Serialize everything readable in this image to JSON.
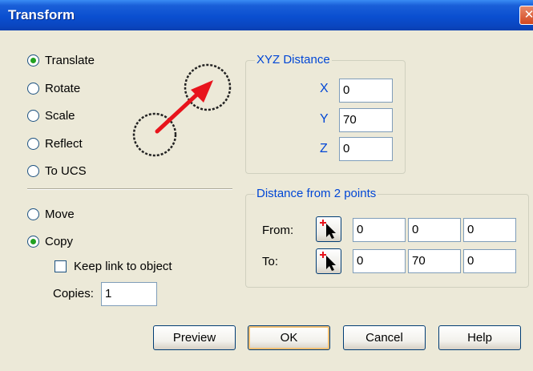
{
  "window": {
    "title": "Transform",
    "close_glyph": "✕"
  },
  "operation": {
    "options": [
      {
        "label": "Translate",
        "checked": true
      },
      {
        "label": "Rotate",
        "checked": false
      },
      {
        "label": "Scale",
        "checked": false
      },
      {
        "label": "Reflect",
        "checked": false
      },
      {
        "label": "To UCS",
        "checked": false
      }
    ]
  },
  "mode": {
    "options": [
      {
        "label": "Move",
        "checked": false
      },
      {
        "label": "Copy",
        "checked": true
      }
    ],
    "keep_link_label": "Keep link to object",
    "keep_link_checked": false,
    "copies_label": "Copies:",
    "copies_value": "1"
  },
  "xyz_distance": {
    "title": "XYZ Distance",
    "x_label": "X",
    "x_value": "0",
    "y_label": "Y",
    "y_value": "70",
    "z_label": "Z",
    "z_value": "0"
  },
  "two_points": {
    "title": "Distance from 2 points",
    "from_label": "From:",
    "from_values": [
      "0",
      "0",
      "0"
    ],
    "to_label": "To:",
    "to_values": [
      "0",
      "70",
      "0"
    ]
  },
  "buttons": {
    "preview": "Preview",
    "ok": "OK",
    "cancel": "Cancel",
    "help": "Help"
  },
  "icons": {
    "illustration": "translate-arrow-icon",
    "pick_point": "pick-point-icon"
  },
  "colors": {
    "accent": "#0046d5",
    "arrow": "#e8141c",
    "radio_dot": "#21a121"
  }
}
